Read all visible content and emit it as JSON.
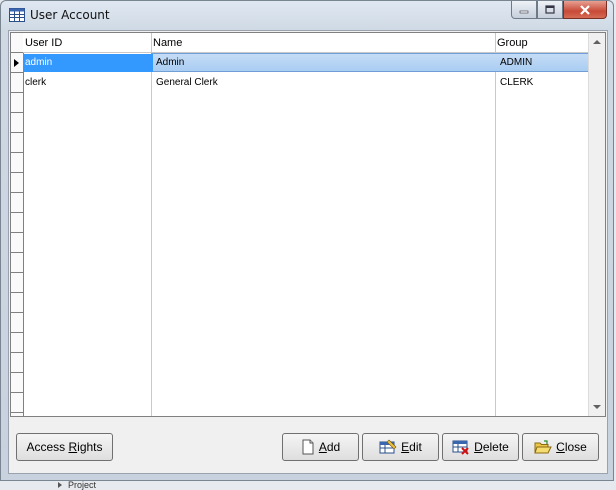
{
  "window": {
    "title": "User Account"
  },
  "grid": {
    "columns": [
      "User ID",
      "Name",
      "Group"
    ],
    "rows": [
      {
        "user_id": "admin",
        "name": "Admin",
        "group": "ADMIN"
      },
      {
        "user_id": "clerk",
        "name": "General Clerk",
        "group": "CLERK"
      }
    ],
    "selected_row": 0
  },
  "buttons": {
    "access_rights": {
      "label": "Access Rights",
      "underline": "R"
    },
    "add": {
      "label_first": "A",
      "label_rest": "dd"
    },
    "edit": {
      "label_first": "E",
      "label_rest": "dit"
    },
    "delete": {
      "label_first": "D",
      "label_rest": "elete"
    },
    "close": {
      "label_first": "C",
      "label_rest": "lose"
    }
  },
  "background": {
    "partial_text": "Project"
  },
  "colors": {
    "selection": "#a9cdf2",
    "focus_cell": "#3399ff",
    "close_button": "#c74a37"
  }
}
